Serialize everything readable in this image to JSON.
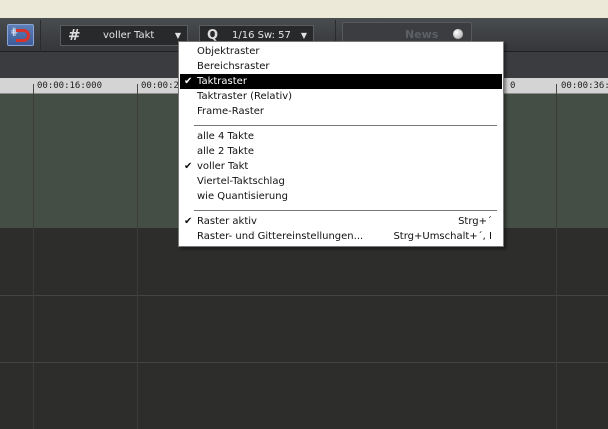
{
  "toolbar": {
    "grid_button_icon": "magnet-grid-icon",
    "raster_dropdown": {
      "icon": "hash-icon",
      "value": "voller Takt"
    },
    "quant_dropdown": {
      "icon": "q-icon",
      "value": "1/16 Sw: 57"
    },
    "news_label": "News"
  },
  "ruler": {
    "labels": [
      "00:00:16:000",
      "00:00:2",
      "0",
      "00:00:36:0"
    ]
  },
  "menu": {
    "group1": [
      {
        "label": "Objektraster",
        "checked": false,
        "selected": false
      },
      {
        "label": "Bereichsraster",
        "checked": false,
        "selected": false
      },
      {
        "label": "Taktraster",
        "checked": true,
        "selected": true
      },
      {
        "label": "Taktraster (Relativ)",
        "checked": false,
        "selected": false
      },
      {
        "label": "Frame-Raster",
        "checked": false,
        "selected": false
      }
    ],
    "group2": [
      {
        "label": "alle 4 Takte",
        "checked": false
      },
      {
        "label": "alle 2 Takte",
        "checked": false
      },
      {
        "label": "voller Takt",
        "checked": true
      },
      {
        "label": "Viertel-Taktschlag",
        "checked": false
      },
      {
        "label": "wie Quantisierung",
        "checked": false
      }
    ],
    "group3": [
      {
        "label": "Raster aktiv",
        "shortcut": "Strg+´",
        "checked": true
      },
      {
        "label": "Raster- und Gittereinstellungen...",
        "shortcut": "Strg+Umschalt+´, I",
        "checked": false
      }
    ],
    "check_glyph": "✔"
  },
  "colors": {
    "menu_highlight": "#000000",
    "track_bg": "#454e44",
    "lower_bg": "#2d2e2b"
  }
}
